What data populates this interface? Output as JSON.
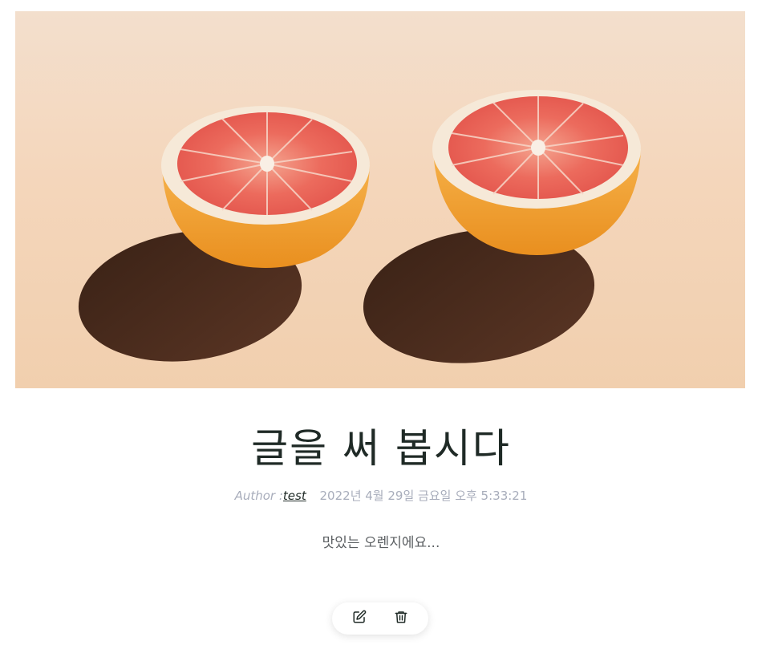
{
  "post": {
    "title": "글을 써 봅시다",
    "author_label": "Author :",
    "author_name": "test",
    "date": "2022년 4월 29일 금요일 오후 5:33:21",
    "content": "맛있는 오렌지에요..."
  },
  "image": {
    "subject": "two grapefruit halves on a peach background"
  },
  "actions": {
    "edit_icon": "edit-icon",
    "delete_icon": "trash-icon"
  },
  "colors": {
    "background": "#ffffff",
    "title": "#1f2a26",
    "meta": "#a8adbb",
    "content": "#5b5f62",
    "hero_bg": "#f4d6bb"
  }
}
